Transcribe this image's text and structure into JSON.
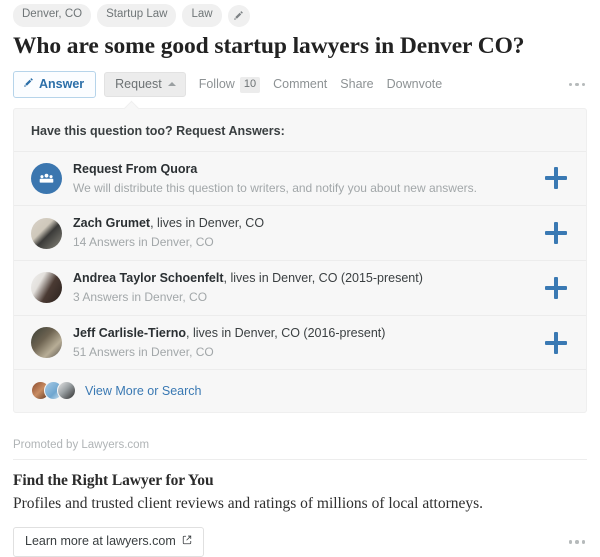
{
  "topics": {
    "tags": [
      "Denver, CO",
      "Startup Law",
      "Law"
    ],
    "edit_icon": "pencil-icon"
  },
  "question": {
    "title": "Who are some good startup lawyers in Denver CO?"
  },
  "actions": {
    "answer_label": "Answer",
    "answer_icon": "pencil-icon",
    "request_label": "Request",
    "request_caret_icon": "caret-up-icon",
    "follow_label": "Follow",
    "follow_count": "10",
    "comment_label": "Comment",
    "share_label": "Share",
    "downvote_label": "Downvote",
    "more_icon": "ellipsis-icon",
    "accent_blue": "#2c6fa8",
    "answer_border": "#b6d4ea"
  },
  "request_panel": {
    "heading": "Have this question too? Request Answers:",
    "background": "#f7f7f7",
    "plus_icon": "plus-icon",
    "plus_color": "#3a79b3",
    "rows": [
      {
        "avatar": "quora-group-icon",
        "name": "Request From Quora",
        "name_is_bold_only": true,
        "credential": "",
        "sub": "We will distribute this question to writers, and notify you about new answers.",
        "action_icon": "plus-icon"
      },
      {
        "avatar": "user-photo-avatar",
        "name": "Zach Grumet",
        "credential": ", lives in Denver, CO",
        "sub": "14 Answers in Denver, CO",
        "action_icon": "plus-icon"
      },
      {
        "avatar": "user-photo-avatar",
        "name": "Andrea Taylor Schoenfelt",
        "credential": ", lives in Denver, CO (2015-present)",
        "sub": "3 Answers in Denver, CO",
        "action_icon": "plus-icon"
      },
      {
        "avatar": "user-photo-avatar",
        "name": "Jeff Carlisle-Tierno",
        "credential": ", lives in Denver, CO (2016-present)",
        "sub": "51 Answers in Denver, CO",
        "action_icon": "plus-icon"
      }
    ],
    "view_more_label": "View More or Search",
    "view_more_avatars": 3,
    "link_color": "#3a79b3"
  },
  "promoted": {
    "label": "Promoted by Lawyers.com",
    "title": "Find the Right Lawyer for You",
    "body": "Profiles and trusted client reviews and ratings of millions of local attorneys.",
    "cta_label": "Learn more at lawyers.com",
    "cta_icon": "external-link-icon",
    "more_icon": "ellipsis-icon"
  }
}
